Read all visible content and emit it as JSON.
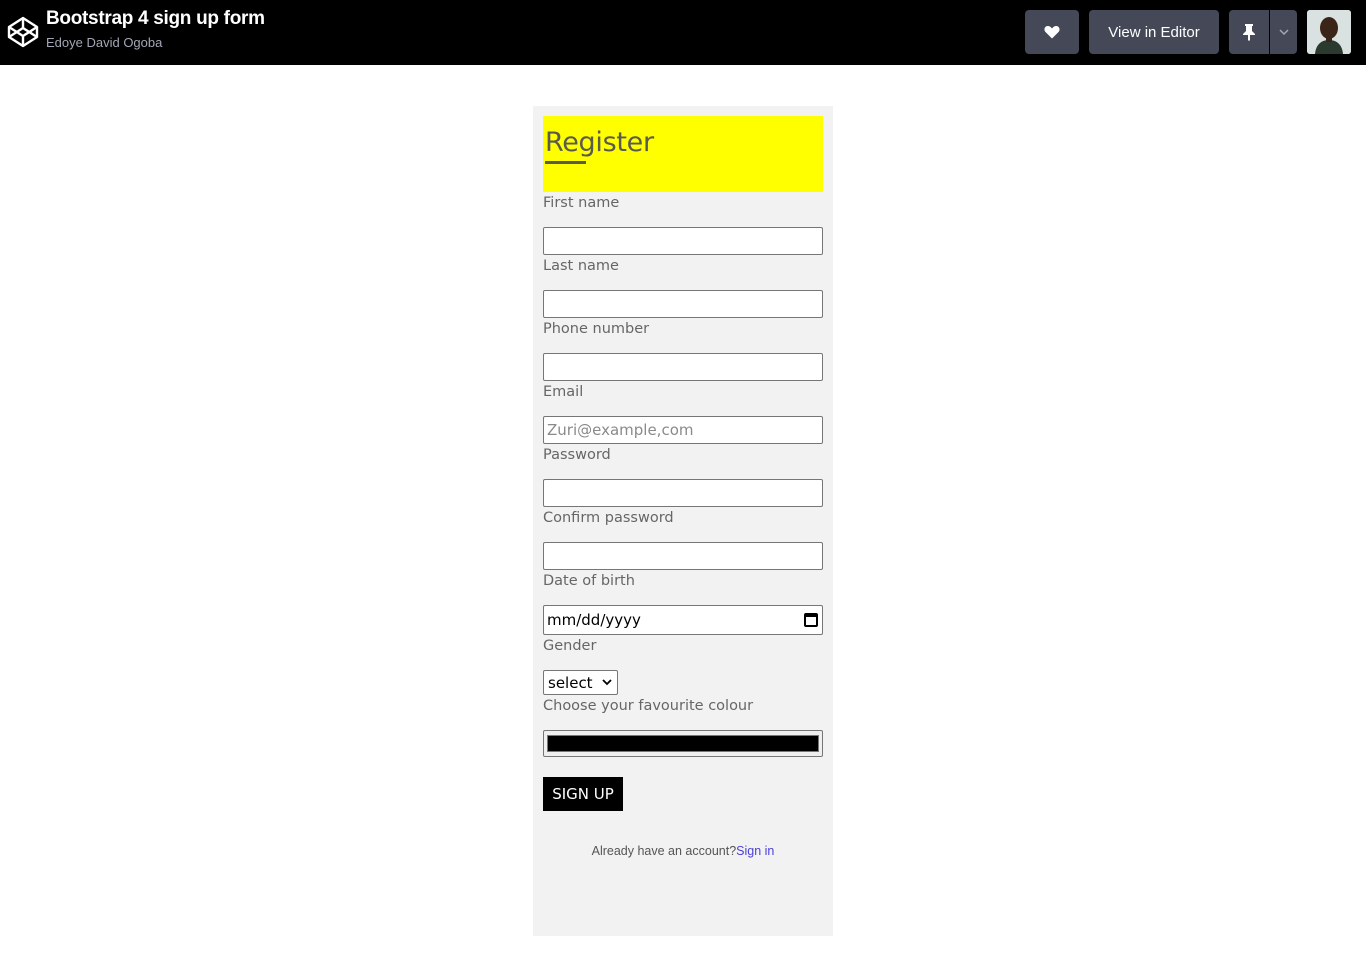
{
  "header": {
    "title": "Bootstrap 4 sign up form",
    "author": "Edoye David Ogoba",
    "view_in_editor": "View in Editor"
  },
  "form": {
    "heading": "Register",
    "first_name_label": "First name",
    "last_name_label": "Last name",
    "phone_label": "Phone number",
    "email_label": "Email",
    "email_placeholder": "Zuri@example,com",
    "password_label": "Password",
    "confirm_password_label": "Confirm password",
    "dob_label": "Date of birth",
    "dob_placeholder": "mm/dd/yyyy",
    "gender_label": "Gender",
    "gender_selected": "select",
    "colour_label": "Choose your favourite colour",
    "colour_value": "#000000",
    "signup_button": "SIGN UP",
    "already_text": "Already have an account?",
    "sign_in_link": "Sign in"
  },
  "colors": {
    "header_bg": "#000000",
    "banner": "#ffff00",
    "card_bg": "#f2f2f2",
    "link": "#4a3fd6"
  }
}
